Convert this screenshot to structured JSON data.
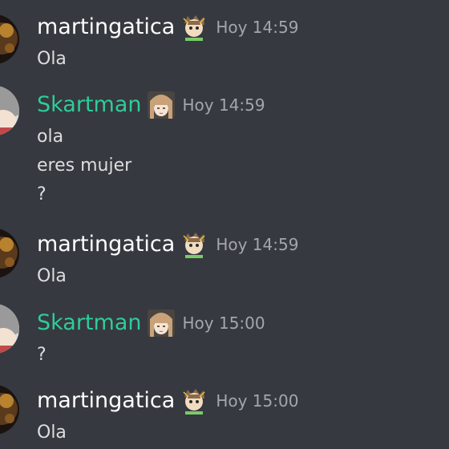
{
  "colors": {
    "background": "#36393f",
    "name_white": "#ffffff",
    "name_green": "#2ecc9a",
    "timestamp": "#a3a6aa",
    "text": "#dcddde"
  },
  "icons": {
    "avatar_martin": "dark-anime-avatar",
    "avatar_skart": "grey-haired-anime-avatar",
    "badge_martin": "anime-character-emoji",
    "badge_skart": "anime-girl-emoji"
  },
  "messages": [
    {
      "author": "martingatica",
      "time": "Hoy 14:59",
      "lines": [
        "Ola"
      ]
    },
    {
      "author": "Skartman",
      "time": "Hoy 14:59",
      "lines": [
        "ola",
        "eres mujer",
        "?"
      ]
    },
    {
      "author": "martingatica",
      "time": "Hoy 14:59",
      "lines": [
        "Ola"
      ]
    },
    {
      "author": "Skartman",
      "time": "Hoy 15:00",
      "lines": [
        "?"
      ]
    },
    {
      "author": "martingatica",
      "time": "Hoy 15:00",
      "lines": [
        "Ola"
      ]
    }
  ]
}
